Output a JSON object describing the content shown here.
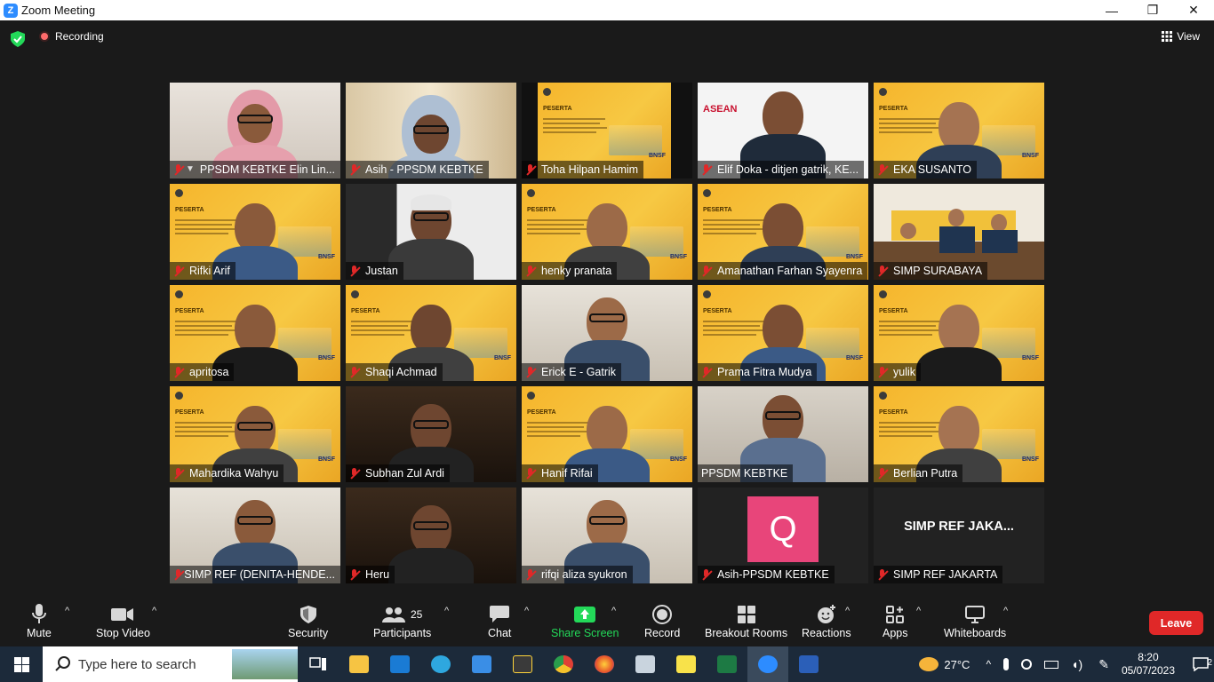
{
  "window": {
    "title": "Zoom Meeting",
    "minimize": "—",
    "maximize": "❐",
    "close": "✕"
  },
  "topbar": {
    "recording_label": "Recording",
    "view_label": "View"
  },
  "participants": [
    {
      "name": "PPSDM KEBTKE Elin Lin...",
      "kind": "hijab"
    },
    {
      "name": "Asih - PPSDM KEBTKE",
      "kind": "hijab2"
    },
    {
      "name": "Toha Hilpan Hamim",
      "kind": "banner"
    },
    {
      "name": "Elif Doka - ditjen gatrik, KE...",
      "kind": "asean"
    },
    {
      "name": "EKA SUSANTO",
      "kind": "banner-person"
    },
    {
      "name": "Rifki Arif",
      "kind": "banner-person"
    },
    {
      "name": "Justan",
      "kind": "cap"
    },
    {
      "name": "henky pranata",
      "kind": "banner-person"
    },
    {
      "name": "Amanathan Farhan Syayenra",
      "kind": "banner-person"
    },
    {
      "name": "SIMP SURABAYA",
      "kind": "group"
    },
    {
      "name": "apritosa",
      "kind": "banner-person"
    },
    {
      "name": "Shaqi Achmad",
      "kind": "banner-person"
    },
    {
      "name": "Erick E - Gatrik",
      "kind": "room-person"
    },
    {
      "name": "Prama Fitra Mudya",
      "kind": "banner-person"
    },
    {
      "name": "yulik",
      "kind": "banner-person"
    },
    {
      "name": "Mahardika Wahyu",
      "kind": "banner-person"
    },
    {
      "name": "Subhan Zul Ardi",
      "kind": "dark-room"
    },
    {
      "name": "Hanif Rifai",
      "kind": "banner-person"
    },
    {
      "name": "PPSDM KEBTKE",
      "kind": "active"
    },
    {
      "name": "Berlian Putra",
      "kind": "banner-person"
    },
    {
      "name": "SIMP REF (DENITA-HENDE...",
      "kind": "room-person"
    },
    {
      "name": "Heru",
      "kind": "dark-room"
    },
    {
      "name": "rifqi aliza syukron",
      "kind": "room-person"
    },
    {
      "name": "Asih-PPSDM KEBTKE",
      "kind": "avatar",
      "avatar_letter": "Q"
    },
    {
      "name": "SIMP REF JAKARTA",
      "kind": "nameonly",
      "display_text": "SIMP REF JAKA..."
    }
  ],
  "banner": {
    "heading": "PESERTA",
    "sponsor": "BNSF"
  },
  "asean": {
    "text": "ASEAN"
  },
  "controls": {
    "mute": "Mute",
    "stop_video": "Stop Video",
    "security": "Security",
    "participants": "Participants",
    "participants_count": "25",
    "chat": "Chat",
    "share_screen": "Share Screen",
    "record": "Record",
    "breakout_rooms": "Breakout Rooms",
    "reactions": "Reactions",
    "apps": "Apps",
    "whiteboards": "Whiteboards",
    "leave": "Leave"
  },
  "taskbar": {
    "search_placeholder": "Type here to search",
    "weather": "27°C",
    "time": "8:20",
    "date": "05/07/2023",
    "notifications": "2"
  },
  "colors": {
    "share_green": "#23d959",
    "leave_red": "#e02828",
    "zoom_blue": "#2d8cff",
    "active_speaker": "#c7e23a"
  }
}
